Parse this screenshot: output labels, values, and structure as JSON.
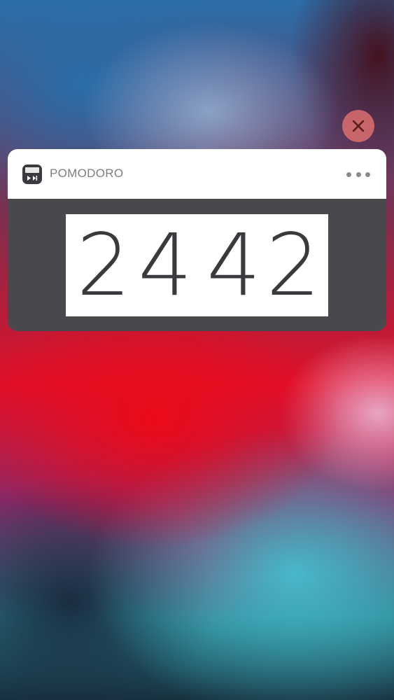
{
  "notification": {
    "app_name": "POMODORO",
    "timer": {
      "minutes": "24",
      "seconds": "42",
      "digits": [
        "2",
        "4",
        "4",
        "2"
      ]
    }
  },
  "icons": {
    "close": "close-icon",
    "more": "more-icon",
    "app": "pomodoro-app-icon"
  },
  "colors": {
    "close_button": "#dc6e6e",
    "card_body": "#49484d",
    "header": "#ffffff",
    "app_name_text": "#7d7d82"
  }
}
